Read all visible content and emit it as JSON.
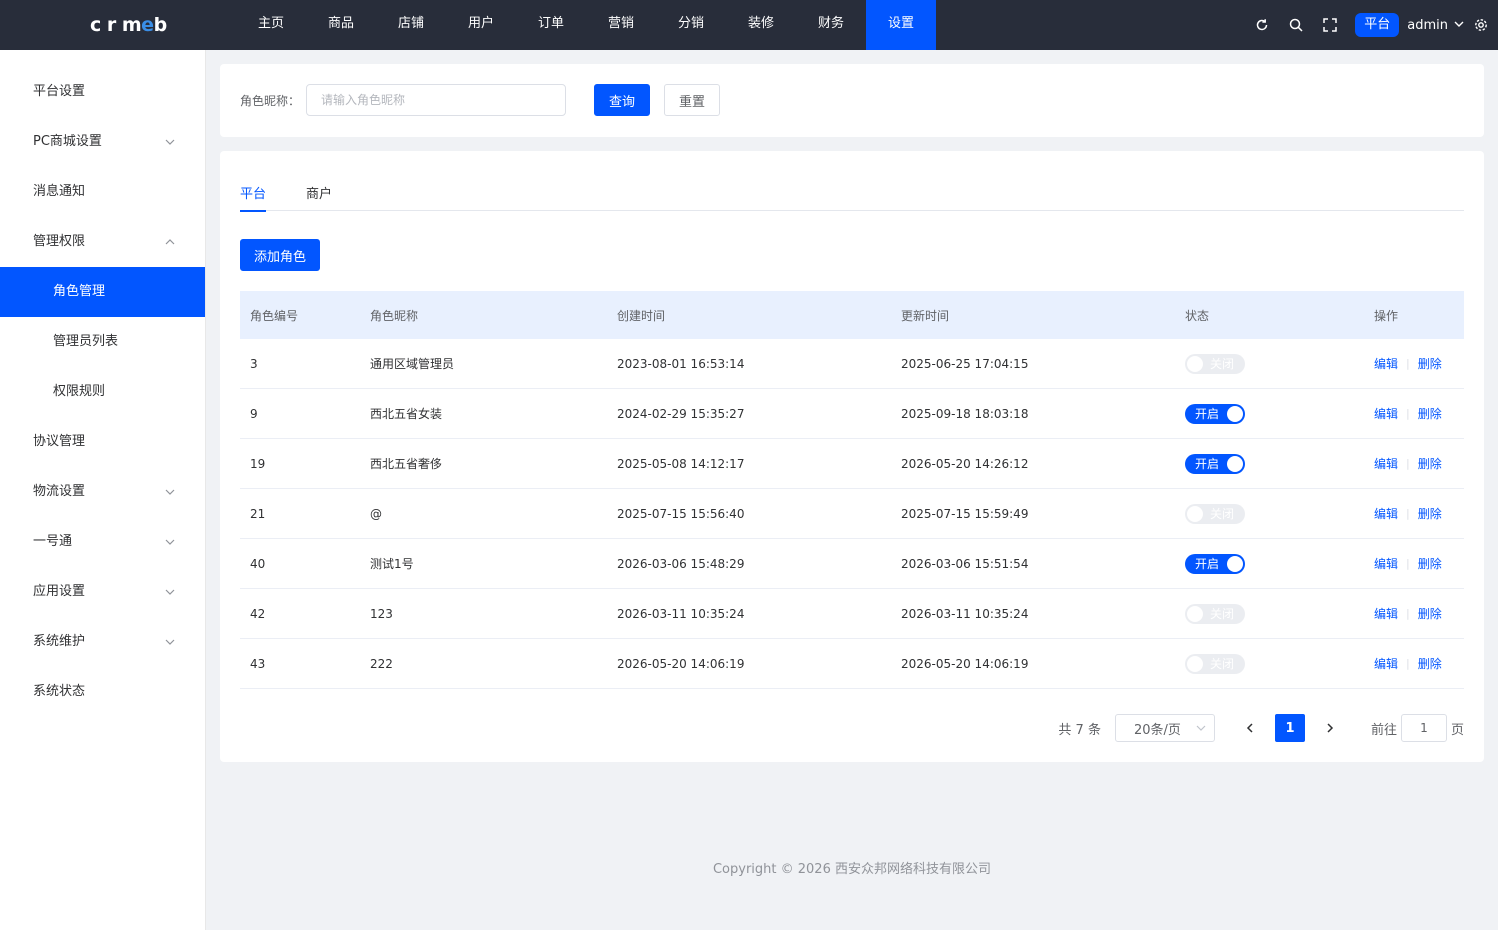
{
  "app": {
    "logo": "crmeb"
  },
  "nav": [
    "主页",
    "商品",
    "店铺",
    "用户",
    "订单",
    "营销",
    "分销",
    "装修",
    "财务",
    "设置"
  ],
  "nav_active_index": 9,
  "header": {
    "platform": "平台",
    "user": "admin"
  },
  "sidebar": [
    {
      "label": "平台设置",
      "arrow": ""
    },
    {
      "label": "PC商城设置",
      "arrow": "down"
    },
    {
      "label": "消息通知",
      "arrow": ""
    },
    {
      "label": "管理权限",
      "arrow": "up"
    },
    {
      "label": "角色管理",
      "sub": true,
      "active": true
    },
    {
      "label": "管理员列表",
      "sub": true
    },
    {
      "label": "权限规则",
      "sub": true
    },
    {
      "label": "协议管理",
      "arrow": ""
    },
    {
      "label": "物流设置",
      "arrow": "down"
    },
    {
      "label": "一号通",
      "arrow": "down"
    },
    {
      "label": "应用设置",
      "arrow": "down"
    },
    {
      "label": "系统维护",
      "arrow": "down"
    },
    {
      "label": "系统状态",
      "arrow": ""
    }
  ],
  "search": {
    "label": "角色昵称：",
    "placeholder": "请输入角色昵称",
    "query": "查询",
    "reset": "重置"
  },
  "tabs": [
    "平台",
    "商户"
  ],
  "add_button": "添加角色",
  "table": {
    "headers": [
      "角色编号",
      "角色昵称",
      "创建时间",
      "更新时间",
      "状态",
      "操作"
    ],
    "rows": [
      {
        "id": "3",
        "name": "通用区域管理员",
        "created": "2023-08-01 16:53:14",
        "updated": "2025-06-25 17:04:15",
        "on": false
      },
      {
        "id": "9",
        "name": "西北五省女装",
        "created": "2024-02-29 15:35:27",
        "updated": "2025-09-18 18:03:18",
        "on": true
      },
      {
        "id": "19",
        "name": "西北五省奢侈",
        "created": "2025-05-08 14:12:17",
        "updated": "2026-05-20 14:26:12",
        "on": true
      },
      {
        "id": "21",
        "name": "@",
        "created": "2025-07-15 15:56:40",
        "updated": "2025-07-15 15:59:49",
        "on": false
      },
      {
        "id": "40",
        "name": "测试1号",
        "created": "2026-03-06 15:48:29",
        "updated": "2026-03-06 15:51:54",
        "on": true
      },
      {
        "id": "42",
        "name": "123",
        "created": "2026-03-11 10:35:24",
        "updated": "2026-03-11 10:35:24",
        "on": false
      },
      {
        "id": "43",
        "name": "222",
        "created": "2026-05-20 14:06:19",
        "updated": "2026-05-20 14:06:19",
        "on": false
      }
    ],
    "switch_on": "开启",
    "switch_off": "关闭",
    "edit": "编辑",
    "delete": "删除"
  },
  "pagination": {
    "total": "共 7 条",
    "page_size": "20条/页",
    "current": "1",
    "goto_prefix": "前往",
    "goto_value": "1",
    "goto_suffix": "页"
  },
  "footer": {
    "copyright": "Copyright © 2026 西安众邦网络科技有限公司"
  }
}
